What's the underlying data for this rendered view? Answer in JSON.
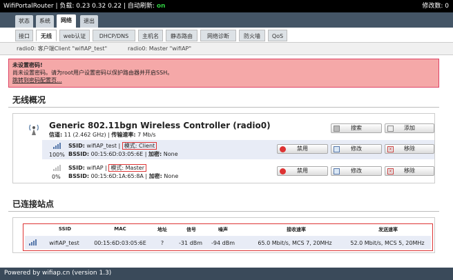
{
  "topbar": {
    "hostname": "WifiPortalRouter",
    "load_label": "负载:",
    "load": "0.23 0.32 0.22",
    "refresh_label": "自动刷新:",
    "refresh": "on",
    "changes": "修改数: 0"
  },
  "menu1": [
    "状态",
    "系统",
    "网络",
    "退出"
  ],
  "menu2": [
    "接口",
    "无线",
    "web认证",
    "DHCP/DNS",
    "主机名",
    "静态路由",
    "网络诊断",
    "防火墙",
    "QoS"
  ],
  "menu3": [
    "radio0: 客户端Client \"wifiAP_test\"",
    "radio0: Master \"wifiAP\""
  ],
  "alert": {
    "title": "未设置密码!",
    "text": "尚未设置密码。请为root用户设置密码以保护路由器并开启SSH。",
    "link": "跳转到密码配置页..."
  },
  "wireless": {
    "heading": "无线概况",
    "device_name": "Generic 802.11bgn Wireless Controller (radio0)",
    "channel_label": "信道:",
    "channel": "11 (2.462 GHz)",
    "rate_label": "传输速率:",
    "rate": "7 Mb/s",
    "scan": "搜索",
    "add": "添加",
    "networks": [
      {
        "percent": "100%",
        "ssid": "wifiAP_test",
        "mode": "模式: Client",
        "bssid": "00:15:6D:03:05:6E",
        "enc": "None",
        "disable": "禁用",
        "edit": "修改",
        "remove": "移除"
      },
      {
        "percent": "0%",
        "ssid": "wifiAP",
        "mode": "模式: Master",
        "bssid": "00:15:6D:1A:65:8A",
        "enc": "None",
        "disable": "禁用",
        "edit": "修改",
        "remove": "移除"
      }
    ],
    "ssid_label": "SSID:",
    "bssid_label": "BSSID:",
    "enc_label": "加密:"
  },
  "stations": {
    "heading": "已连接站点",
    "columns": [
      "SSID",
      "MAC",
      "地址",
      "信号",
      "噪声",
      "接收速率",
      "发送速率"
    ],
    "rows": [
      [
        "wifiAP_test",
        "00:15:6D:03:05:6E",
        "?",
        "-31 dBm",
        "-94 dBm",
        "65.0 Mbit/s, MCS 7, 20MHz",
        "52.0 Mbit/s, MCS 5, 20MHz"
      ]
    ]
  },
  "footer": "Powered by wifiap.cn (version 1.3)"
}
